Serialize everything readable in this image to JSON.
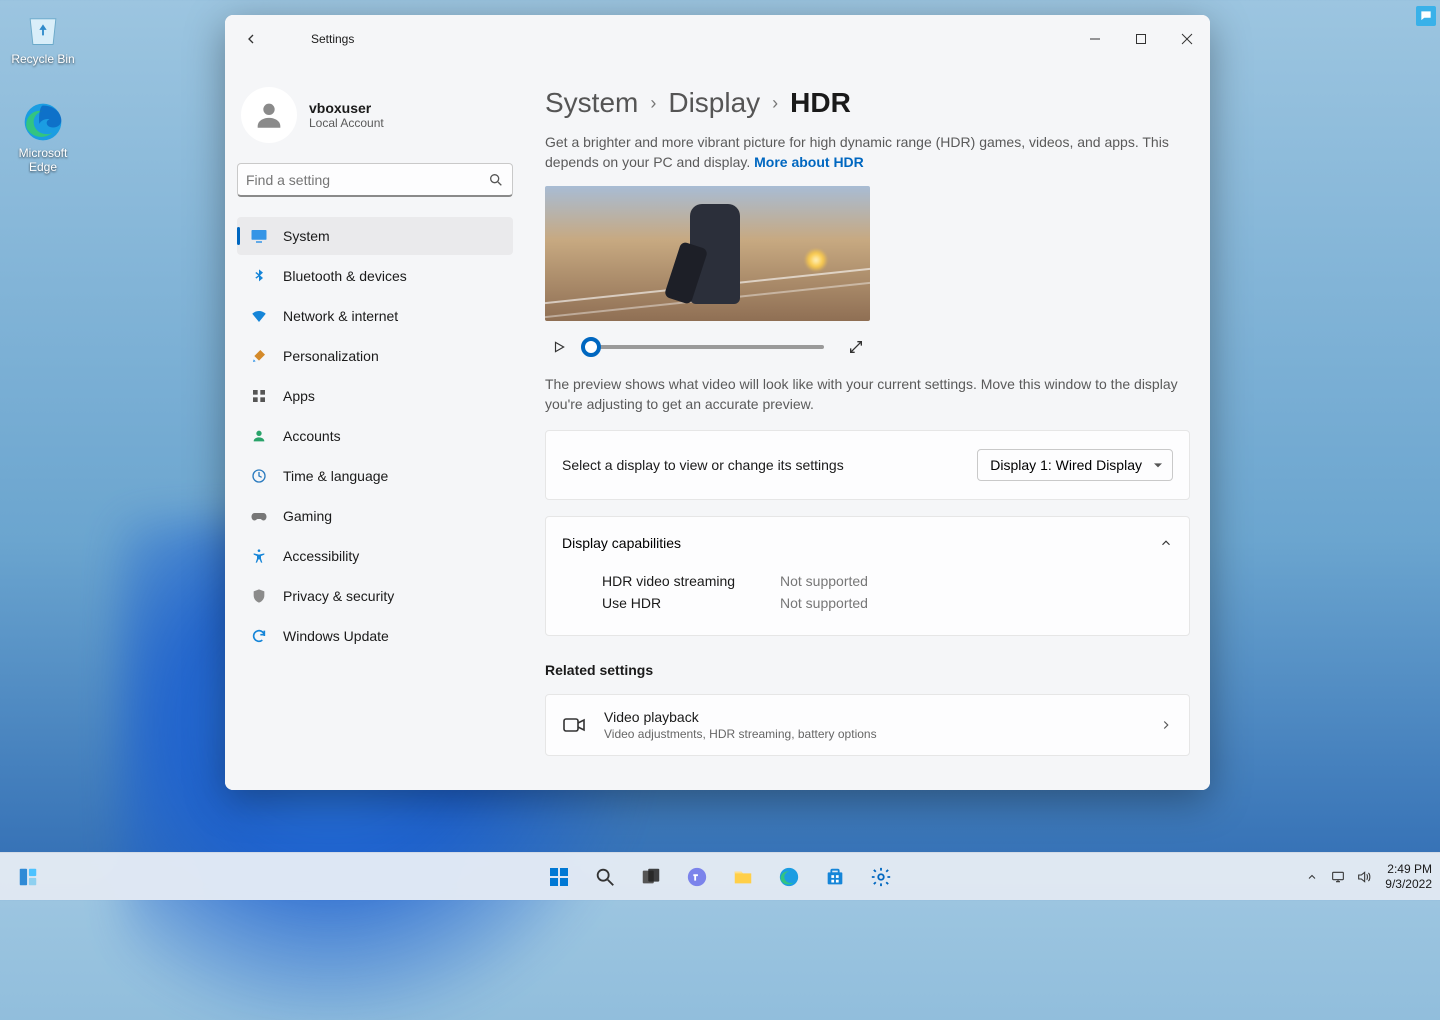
{
  "desktop": {
    "recycle_bin": "Recycle Bin",
    "edge": "Microsoft Edge"
  },
  "window": {
    "title": "Settings",
    "user": {
      "name": "vboxuser",
      "sub": "Local Account"
    },
    "search_placeholder": "Find a setting",
    "nav": {
      "system": "System",
      "bluetooth": "Bluetooth & devices",
      "network": "Network & internet",
      "personalization": "Personalization",
      "apps": "Apps",
      "accounts": "Accounts",
      "time": "Time & language",
      "gaming": "Gaming",
      "accessibility": "Accessibility",
      "privacy": "Privacy & security",
      "update": "Windows Update"
    },
    "breadcrumb": {
      "a": "System",
      "b": "Display",
      "c": "HDR"
    },
    "desc": "Get a brighter and more vibrant picture for high dynamic range (HDR) games, videos, and apps. This depends on your PC and display. ",
    "desc_link": "More about HDR",
    "preview_note": "The preview shows what video will look like with your current settings. Move this window to the display you're adjusting to get an accurate preview.",
    "select_display": {
      "label": "Select a display to view or change its settings",
      "value": "Display 1: Wired Display"
    },
    "capabilities": {
      "title": "Display capabilities",
      "hdr_stream_k": "HDR video streaming",
      "hdr_stream_v": "Not supported",
      "use_hdr_k": "Use HDR",
      "use_hdr_v": "Not supported"
    },
    "related_title": "Related settings",
    "related": {
      "title": "Video playback",
      "sub": "Video adjustments, HDR streaming, battery options"
    }
  },
  "taskbar": {
    "time": "2:49 PM",
    "date": "9/3/2022"
  }
}
